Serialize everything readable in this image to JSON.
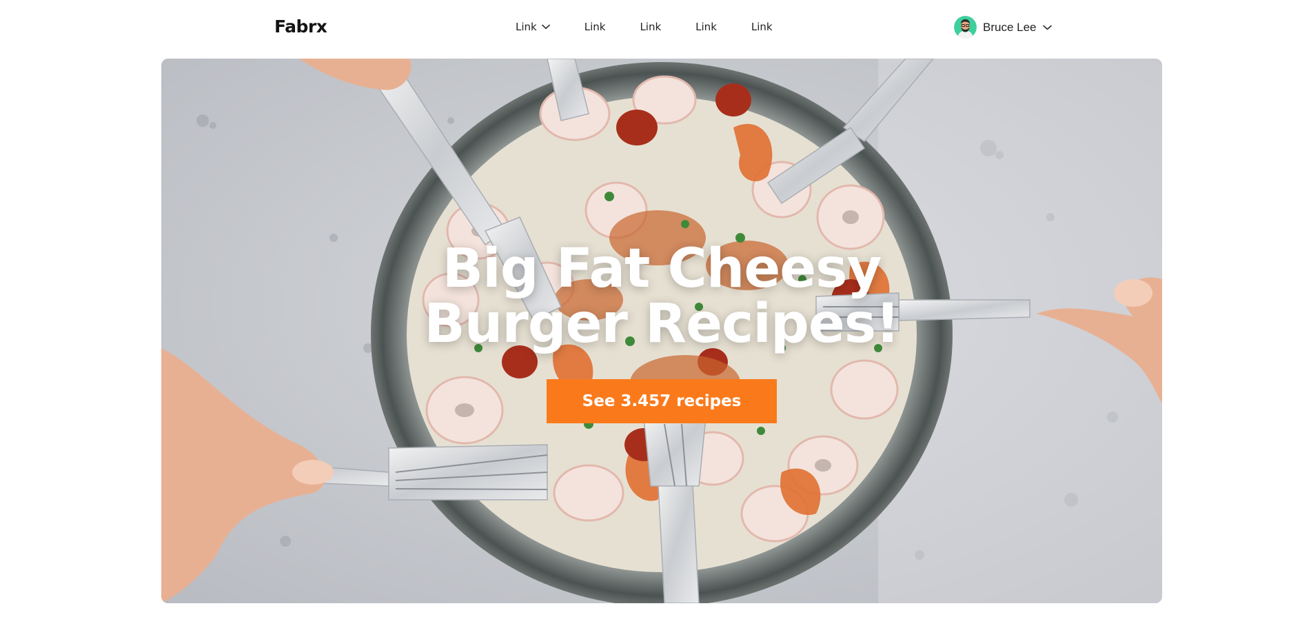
{
  "brand": {
    "logo": "Fabrx"
  },
  "nav": {
    "links": [
      {
        "label": "Link",
        "has_dropdown": true,
        "icon": "chevron-down-icon"
      },
      {
        "label": "Link"
      },
      {
        "label": "Link"
      },
      {
        "label": "Link"
      },
      {
        "label": "Link"
      }
    ]
  },
  "user": {
    "name": "Bruce Lee",
    "avatar_icon": "avatar-icon",
    "menu_icon": "chevron-down-icon",
    "avatar_bg": "#3ecf9c"
  },
  "hero": {
    "headline_line1": "Big Fat Cheesy",
    "headline_line2": "Burger Recipes!",
    "cta_label": "See 3.457 recipes",
    "cta_color": "#fa7a1b",
    "background": "food-plate-with-forks-photo"
  }
}
